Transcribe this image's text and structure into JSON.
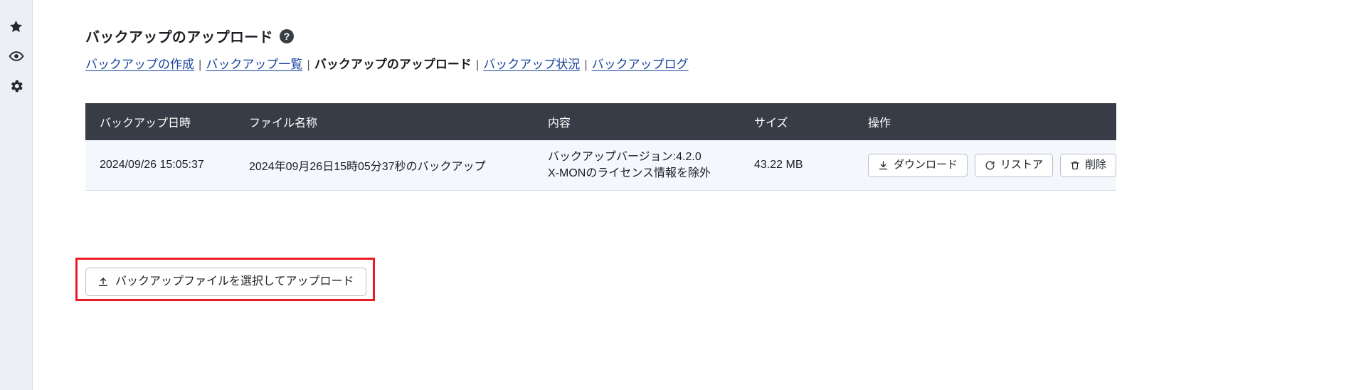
{
  "sidebar": {
    "items": [
      {
        "name": "favorites",
        "icon": "star-icon"
      },
      {
        "name": "watch",
        "icon": "eye-icon"
      },
      {
        "name": "settings",
        "icon": "gear-icon"
      }
    ]
  },
  "header": {
    "title": "バックアップのアップロード",
    "help_label": "?"
  },
  "nav": {
    "separator": "|",
    "items": [
      {
        "label": "バックアップの作成",
        "current": false
      },
      {
        "label": "バックアップ一覧",
        "current": false
      },
      {
        "label": "バックアップのアップロード",
        "current": true
      },
      {
        "label": "バックアップ状況",
        "current": false
      },
      {
        "label": "バックアップログ",
        "current": false
      }
    ]
  },
  "table": {
    "columns": [
      "バックアップ日時",
      "ファイル名称",
      "内容",
      "サイズ",
      "操作"
    ],
    "rows": [
      {
        "datetime": "2024/09/26 15:05:37",
        "filename": "2024年09月26日15時05分37秒のバックアップ",
        "desc_line1": "バックアップバージョン:4.2.0",
        "desc_line2": "X-MONのライセンス情報を除外",
        "size": "43.22 MB",
        "actions": [
          {
            "label": "ダウンロード",
            "icon": "download-icon"
          },
          {
            "label": "リストア",
            "icon": "restore-icon"
          },
          {
            "label": "削除",
            "icon": "trash-icon"
          }
        ]
      }
    ]
  },
  "upload": {
    "button_label": "バックアップファイルを選択してアップロード",
    "button_icon": "upload-icon",
    "highlight_color": "#ec1c24"
  },
  "colors": {
    "link": "#15429b",
    "table_header_bg": "#373c46",
    "row_bg": "#f4f7fc",
    "sidebar_bg": "#eceff4",
    "text": "#1b1f23"
  }
}
